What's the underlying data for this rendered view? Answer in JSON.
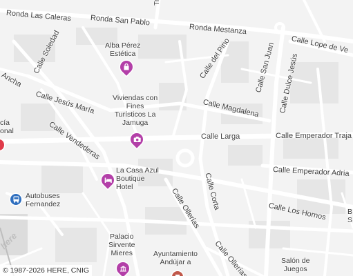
{
  "colors": {
    "road": "#ffffff",
    "block": "#e7e7e7",
    "pin": "#b33fa8",
    "bus": "#2f6fbf",
    "red": "#e03b4a"
  },
  "streets": {
    "ronda_las_caleras": "Ronda Las Caleras",
    "ronda_san_pablo": "Ronda San Pablo",
    "travesia": "Trav",
    "ronda_mestanza": "Ronda Mestanza",
    "calle_lope_de_vega": "Calle Lope de Ve",
    "calle_soledad": "Calle Soledad",
    "calle_del_pino": "Calle del Pino",
    "calle_san_juan": "Calle San Juan",
    "ancha": "Ancha",
    "calle_jesus_maria": "Calle Jesús María",
    "calle_dulce_jesus": "Calle Dulce Jesús",
    "calle_magdalena": "Calle Magdalena",
    "calle_vendederas": "Calle Vendederas",
    "calle_larga": "Calle Larga",
    "calle_emperador_traja": "Calle Emperador Traja",
    "calle_corta": "Calle Corta",
    "calle_emperador_adria": "Calle Emperador Adria",
    "calle_ollerias_1": "Calle Ollerías",
    "calle_los_hornos": "Calle Los Hornos",
    "calle_ollerias_2": "Calle Ollerías"
  },
  "pois": {
    "alba_line1": "Alba Pérez",
    "alba_line2": "Estética",
    "viviendas_line1": "Viviendas con",
    "viviendas_line2": "Fines",
    "viviendas_line3": "Turísticos La",
    "viviendas_line4": "Jamuga",
    "lacasa_line1": "La Casa Azul",
    "lacasa_line2": "Boutique",
    "lacasa_line3": "Hotel",
    "autobuses_line1": "Autobuses",
    "autobuses_line2": "Fernandez",
    "palacio_line1": "Palacio",
    "palacio_line2": "Sirvente",
    "palacio_line3": "Mieres",
    "ayto_line1": "Ayuntamiento",
    "ayto_line2": "Andújar a",
    "salon_line1": "Salón de",
    "salon_line2": "Juegos",
    "cia_line1": "cía",
    "cia_line2": "onal",
    "edge_b": "B",
    "edge_s": "S"
  },
  "copyright": "© 1987-2026 HERE, CNIG",
  "watermark": "here"
}
